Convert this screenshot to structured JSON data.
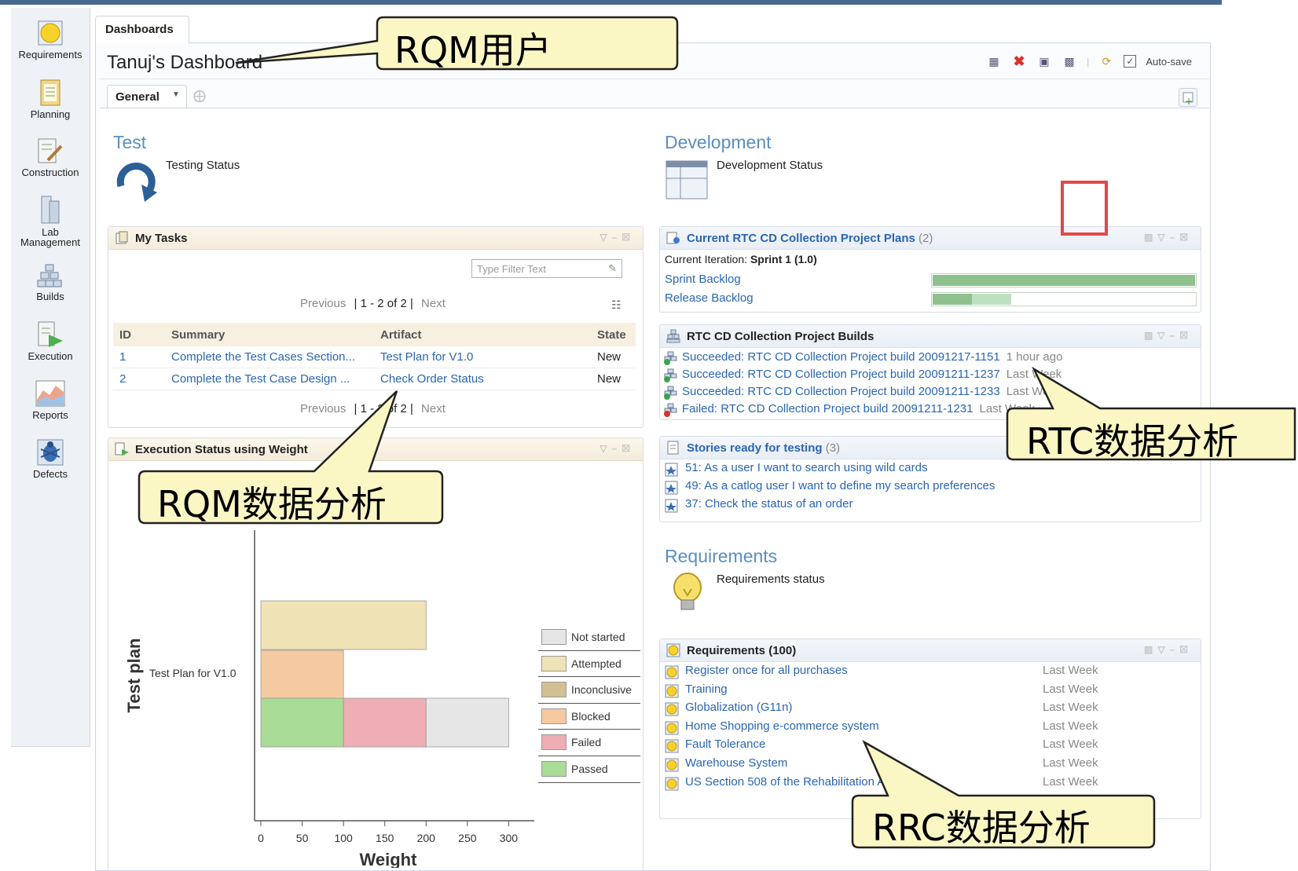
{
  "nav": {
    "items": [
      {
        "label": "Requirements",
        "icon": "requirements-icon"
      },
      {
        "label": "Planning",
        "icon": "planning-icon"
      },
      {
        "label": "Construction",
        "icon": "construction-icon"
      },
      {
        "label_line1": "Lab",
        "label_line2": "Management",
        "icon": "lab-management-icon"
      },
      {
        "label": "Builds",
        "icon": "builds-icon"
      },
      {
        "label": "Execution",
        "icon": "execution-icon"
      },
      {
        "label": "Reports",
        "icon": "reports-icon"
      },
      {
        "label": "Defects",
        "icon": "defects-icon"
      }
    ]
  },
  "header": {
    "tab": "Dashboards",
    "title": "Tanuj's Dashboard",
    "autosave_label": "Auto-save",
    "autosave_checked": true,
    "general_tab": "General"
  },
  "test_section": {
    "title": "Test",
    "status_label": "Testing Status"
  },
  "my_tasks": {
    "title": "My Tasks",
    "filter_placeholder": "Type Filter Text",
    "pager_prev": "Previous",
    "pager_range": "| 1 - 2 of 2 |",
    "pager_next": "Next",
    "pager_range_bottom": "| 1 - 2 of 2 |",
    "columns": [
      "ID",
      "Summary",
      "Artifact",
      "State"
    ],
    "rows": [
      {
        "id": "1",
        "summary": "Complete the Test Cases Section...",
        "artifact": "Test Plan for V1.0",
        "state": "New"
      },
      {
        "id": "2",
        "summary": "Complete the Test Case Design ...",
        "artifact": "Check Order Status",
        "state": "New"
      }
    ]
  },
  "execution": {
    "title": "Execution Status using Weight"
  },
  "chart_data": {
    "type": "bar",
    "orientation": "horizontal",
    "stacked": true,
    "ylabel": "Test plan",
    "xlabel": "Weight",
    "xlim": [
      0,
      350
    ],
    "x_ticks": [
      "0",
      "50",
      "100",
      "150",
      "200",
      "250",
      "300",
      "350"
    ],
    "categories": [
      "Test Plan for V1.0"
    ],
    "series": [
      {
        "name": "Not started",
        "color": "#e6e6e6"
      },
      {
        "name": "Attempted",
        "color": "#efe2b4"
      },
      {
        "name": "Inconclusive",
        "color": "#d2c093"
      },
      {
        "name": "Blocked",
        "color": "#f6caa0"
      },
      {
        "name": "Failed",
        "color": "#eeaeb4"
      },
      {
        "name": "Passed",
        "color": "#a9dc96"
      }
    ],
    "bars": [
      {
        "series": "Attempted",
        "start": 0,
        "end": 200,
        "row": 0
      },
      {
        "series": "Blocked",
        "start": 0,
        "end": 100,
        "row": 1
      },
      {
        "series": "Passed",
        "start": 0,
        "end": 100,
        "row": 2
      },
      {
        "series": "Failed",
        "start": 100,
        "end": 200,
        "row": 2
      },
      {
        "series": "Not started",
        "start": 200,
        "end": 300,
        "row": 2
      }
    ],
    "legend": "right"
  },
  "dev_section": {
    "title": "Development",
    "status_label": "Development Status"
  },
  "plans": {
    "title": "Current RTC CD Collection Project Plans",
    "count": "(2)",
    "iteration_label": "Current Iteration:",
    "iteration_value": "Sprint 1 (1.0)",
    "items": [
      {
        "label": "Sprint Backlog",
        "progress": 1.0
      },
      {
        "label": "Release Backlog",
        "progress": 0.3
      }
    ]
  },
  "builds": {
    "title": "RTC CD Collection Project Builds",
    "items": [
      {
        "text": "Succeeded: RTC CD Collection Project build 20091217-1151",
        "time": "1 hour ago",
        "status": "success"
      },
      {
        "text": "Succeeded: RTC CD Collection Project build 20091211-1237",
        "time": "Last Week",
        "status": "success"
      },
      {
        "text": "Succeeded: RTC CD Collection Project build 20091211-1233",
        "time": "Last Week",
        "status": "success"
      },
      {
        "text": "Failed: RTC CD Collection Project build 20091211-1231",
        "time": "Last Week",
        "status": "failed"
      }
    ]
  },
  "stories": {
    "title": "Stories ready for testing",
    "count": "(3)",
    "items": [
      "51: As a user I want to search using wild cards",
      "49: As a catlog user I want to define my search preferences",
      "37: Check the status of an order"
    ]
  },
  "req_section": {
    "title": "Requirements",
    "status_label": "Requirements status"
  },
  "requirements": {
    "title": "Requirements (100)",
    "items": [
      {
        "label": "Register once for all purchases",
        "time": "Last Week"
      },
      {
        "label": "Training",
        "time": "Last Week"
      },
      {
        "label": "Globalization (G11n)",
        "time": "Last Week"
      },
      {
        "label": "Home Shopping e-commerce system",
        "time": "Last Week"
      },
      {
        "label": "Fault Tolerance",
        "time": "Last Week"
      },
      {
        "label": "Warehouse System",
        "time": "Last Week"
      },
      {
        "label": "US Section 508 of the Rehabilitation Act",
        "time": "Last Week"
      }
    ]
  },
  "callouts": {
    "rqm_user": "RQM用户",
    "rqm_analysis": "RQM数据分析",
    "rtc_analysis": "RTC数据分析",
    "rrc_analysis": "RRC数据分析"
  },
  "colors": {
    "section_title": "#5a8fc0",
    "link": "#2a66b2",
    "callout_fill": "#fbf7c4",
    "highlight_box": "#e64646",
    "progress": "#8fc18f"
  }
}
